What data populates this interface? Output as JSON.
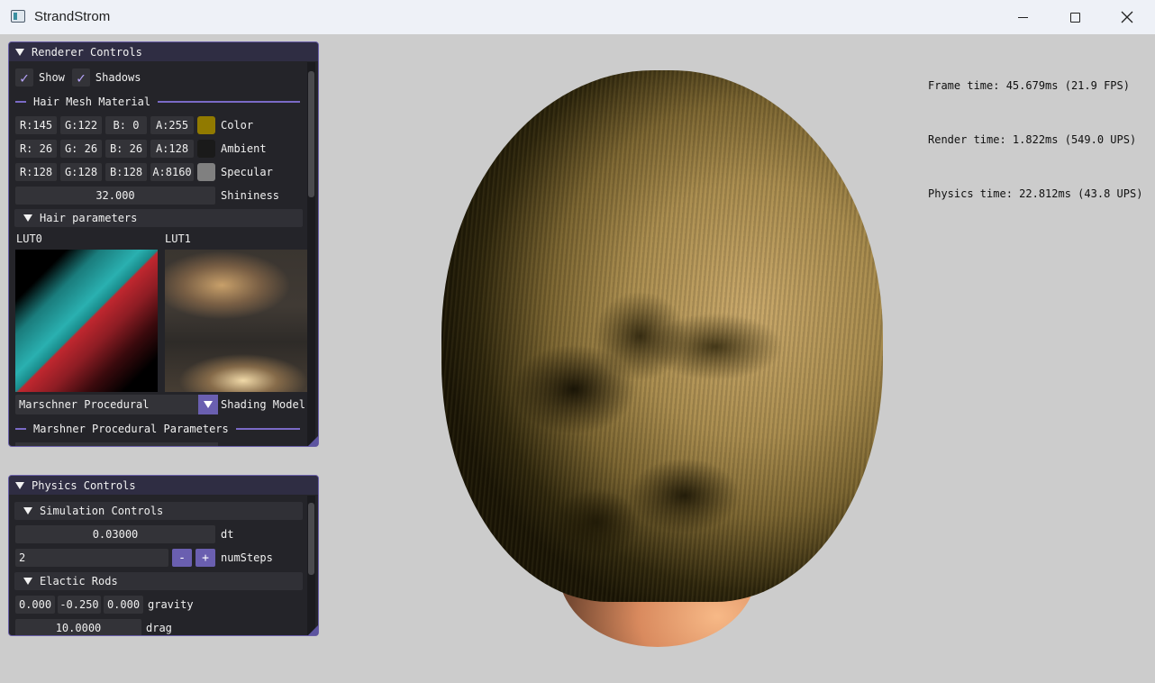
{
  "window": {
    "title": "StrandStrom"
  },
  "stats": {
    "frame_time": "Frame time: 45.679ms (21.9 FPS)",
    "render_time": "Render time: 1.822ms (549.0 UPS)",
    "physics_time": "Physics time: 22.812ms (43.8 UPS)"
  },
  "renderer": {
    "header": "Renderer Controls",
    "show_label": "Show",
    "shadows_label": "Shadows",
    "hair_mesh_material": "Hair Mesh Material",
    "color": {
      "r": "R:145",
      "g": "G:122",
      "b": "B:  0",
      "a": "A:255",
      "label": "Color",
      "swatch": "#917a00"
    },
    "ambient": {
      "r": "R: 26",
      "g": "G: 26",
      "b": "B: 26",
      "a": "A:128",
      "label": "Ambient",
      "swatch": "#1a1a1a"
    },
    "specular": {
      "r": "R:128",
      "g": "G:128",
      "b": "B:128",
      "a": "A:8160",
      "label": "Specular",
      "swatch": "#808080"
    },
    "shininess": {
      "value": "32.000",
      "label": "Shininess"
    },
    "hair_parameters": "Hair parameters",
    "lut0": "LUT0",
    "lut1": "LUT1",
    "shading_model": {
      "value": "Marschner Procedural",
      "label": "Shading Model"
    },
    "marschner_params": "Marshner Procedural Parameters"
  },
  "physics": {
    "header": "Physics Controls",
    "simulation_controls": "Simulation Controls",
    "dt": {
      "value": "0.03000",
      "label": "dt"
    },
    "num_steps": {
      "value": "2",
      "minus": "-",
      "plus": "+",
      "label": "numSteps"
    },
    "elastic_rods": "Elactic Rods",
    "gravity": {
      "x": "0.000",
      "y": "-0.250",
      "z": "0.000",
      "label": "gravity"
    },
    "drag": {
      "value": "10.0000",
      "label": "drag"
    }
  }
}
